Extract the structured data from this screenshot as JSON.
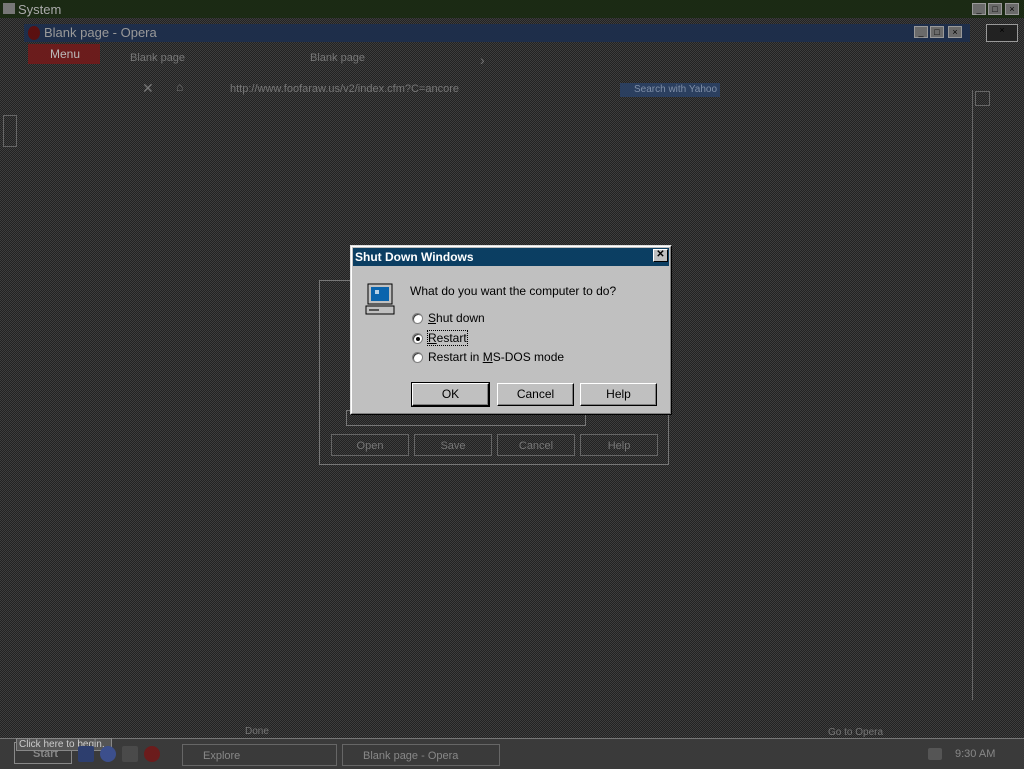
{
  "system_bar": {
    "title": "System"
  },
  "browser": {
    "title": "Blank page - Opera",
    "menu_label": "Menu",
    "tabs": [
      "Blank page",
      "Blank page"
    ],
    "address": "http://www.foofaraw.us/v2/index.cfm?C=ancore",
    "search_placeholder": "Search with Yahoo",
    "status_left": "Done",
    "status_right": "Go to Opera"
  },
  "bg_dialog": {
    "buttons": [
      "Open",
      "Save",
      "Cancel",
      "Help"
    ]
  },
  "dialog": {
    "title": "Shut Down Windows",
    "close_label": "✕",
    "question": "What do you want the computer to do?",
    "options": [
      {
        "label": "Shut down",
        "mnemonic": "S",
        "selected": false
      },
      {
        "label": "Restart",
        "mnemonic": "R",
        "selected": true
      },
      {
        "label": "Restart in MS-DOS mode",
        "mnemonic": "M",
        "selected": false
      }
    ],
    "buttons": {
      "ok": "OK",
      "cancel": "Cancel",
      "help": "Help"
    },
    "colors": {
      "titlebar": "#0b3e62",
      "face": "#c0c0c0"
    }
  },
  "taskbar": {
    "start_label": "Start",
    "tooltip": "Click here to begin.",
    "tasks": [
      {
        "label": "Explore",
        "icon": "folder-icon"
      },
      {
        "label": "Blank page - Opera",
        "icon": "opera-icon"
      }
    ],
    "clock": "9:30 AM"
  }
}
